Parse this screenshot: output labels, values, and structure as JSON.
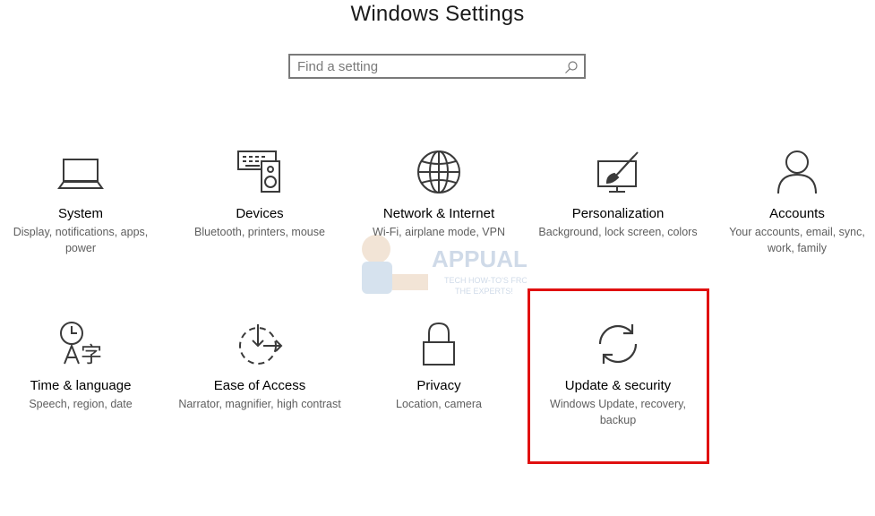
{
  "window": {
    "title": "Windows Settings"
  },
  "search": {
    "placeholder": "Find a setting",
    "value": ""
  },
  "tiles": [
    {
      "name": "System",
      "description": "Display, notifications, apps, power",
      "icon": "laptop-icon"
    },
    {
      "name": "Devices",
      "description": "Bluetooth, printers, mouse",
      "icon": "keyboard-speaker-icon"
    },
    {
      "name": "Network & Internet",
      "description": "Wi-Fi, airplane mode, VPN",
      "icon": "globe-icon"
    },
    {
      "name": "Personalization",
      "description": "Background, lock screen, colors",
      "icon": "paintbrush-icon"
    },
    {
      "name": "Accounts",
      "description": "Your accounts, email, sync, work, family",
      "icon": "person-icon"
    },
    {
      "name": "Time & language",
      "description": "Speech, region, date",
      "icon": "clock-language-icon"
    },
    {
      "name": "Ease of Access",
      "description": "Narrator, magnifier, high contrast",
      "icon": "ease-of-access-icon"
    },
    {
      "name": "Privacy",
      "description": "Location, camera",
      "icon": "lock-icon"
    },
    {
      "name": "Update & security",
      "description": "Windows Update, recovery, backup",
      "icon": "sync-arrows-icon"
    }
  ],
  "highlight": {
    "target": "Update & security",
    "color": "#e01010"
  },
  "watermark": {
    "brand": "APPUALS",
    "tagline": "TECH HOW-TO'S FROM THE EXPERTS!"
  },
  "colors": {
    "text": "#000000",
    "secondary_text": "#5e5e5e",
    "icon_stroke": "#3a3a3a",
    "search_border": "#7a7a7a"
  }
}
